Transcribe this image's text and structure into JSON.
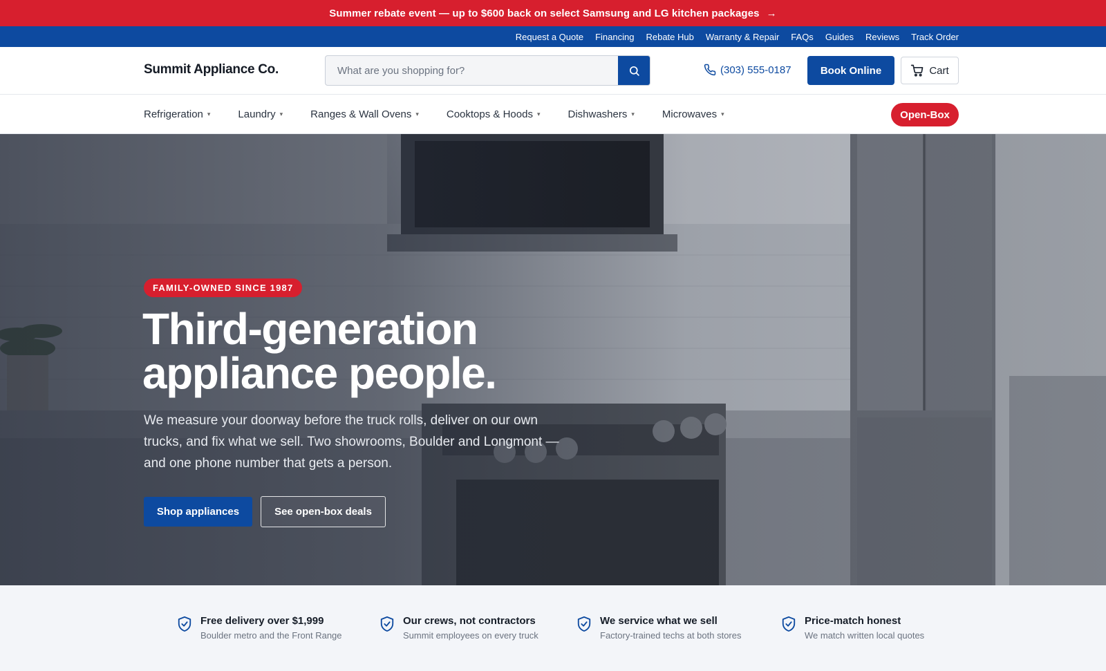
{
  "promo": {
    "text": "Summer rebate event — up to $600 back on select Samsung and LG kitchen packages",
    "arrow": "→"
  },
  "utility_nav": [
    "Request a Quote",
    "Financing",
    "Rebate Hub",
    "Warranty & Repair",
    "FAQs",
    "Guides",
    "Reviews",
    "Track Order"
  ],
  "header": {
    "logo": "Summit Appliance Co.",
    "search_placeholder": "What are you shopping for?",
    "phone": "(303) 555-0187",
    "book_label": "Book Online",
    "cart_label": "Cart"
  },
  "category_nav": {
    "items": [
      "Refrigeration",
      "Laundry",
      "Ranges & Wall Ovens",
      "Cooktops & Hoods",
      "Dishwashers",
      "Microwaves"
    ],
    "openbox_label": "Open-Box"
  },
  "hero": {
    "badge": "FAMILY-OWNED SINCE 1987",
    "title_line1": "Third-generation",
    "title_line2": "appliance people.",
    "body": "We measure your doorway before the truck rolls, deliver on our own trucks, and fix what we sell. Two showrooms, Boulder and Longmont — and one phone number that gets a person.",
    "primary_cta": "Shop appliances",
    "secondary_cta": "See open-box deals"
  },
  "value_props": [
    {
      "title": "Free delivery over $1,999",
      "subtitle": "Boulder metro and the Front Range"
    },
    {
      "title": "Our crews, not contractors",
      "subtitle": "Summit employees on every truck"
    },
    {
      "title": "We service what we sell",
      "subtitle": "Factory-trained techs at both stores"
    },
    {
      "title": "Price-match honest",
      "subtitle": "We match written local quotes"
    }
  ],
  "colors": {
    "brand_blue": "#0d4aa0",
    "accent_red": "#d71f2e",
    "page_bg": "#f3f5f9"
  },
  "icons": {
    "search": "search-icon",
    "phone": "phone-icon",
    "cart": "cart-icon",
    "chevron": "chevron-down-icon",
    "shield": "shield-check-icon",
    "arrow": "arrow-right-icon"
  }
}
